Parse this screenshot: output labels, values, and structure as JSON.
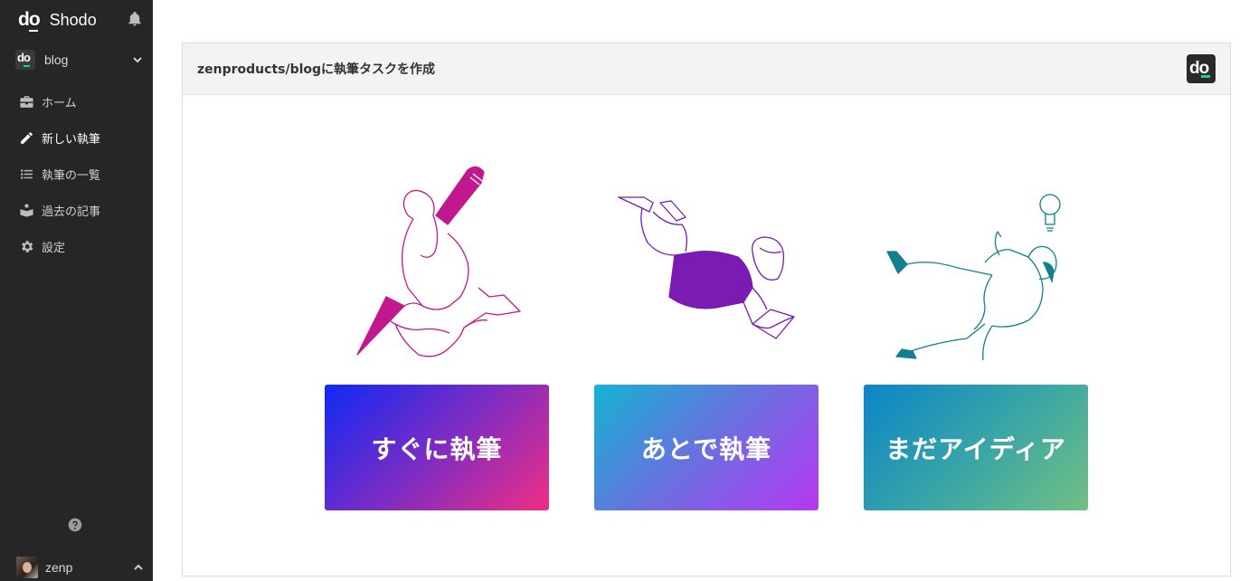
{
  "app": {
    "brand_name": "Shodo",
    "logo_text": "do"
  },
  "sidebar": {
    "project": {
      "name": "blog",
      "logo_text": "do"
    },
    "items": [
      {
        "label": "ホーム",
        "icon": "briefcase-icon"
      },
      {
        "label": "新しい執筆",
        "icon": "pencil-icon",
        "active": true
      },
      {
        "label": "執筆の一覧",
        "icon": "list-icon"
      },
      {
        "label": "過去の記事",
        "icon": "archive-icon"
      },
      {
        "label": "設定",
        "icon": "gear-icon"
      }
    ],
    "user": {
      "name": "zenp"
    }
  },
  "main": {
    "title": "zenproducts/blogに執筆タスクを作成",
    "logo_text": "do",
    "actions": [
      {
        "label": "すぐに執筆",
        "illustration": "woman-riding-pencil",
        "accent": "#c2188f"
      },
      {
        "label": "あとで執筆",
        "illustration": "woman-lying-with-laptop",
        "accent": "#7a1bb3"
      },
      {
        "label": "まだアイディア",
        "illustration": "woman-with-lightbulb",
        "accent": "#117f8e"
      }
    ]
  },
  "colors": {
    "sidebar_bg": "#262626",
    "accent_green": "#1fcf9f"
  }
}
